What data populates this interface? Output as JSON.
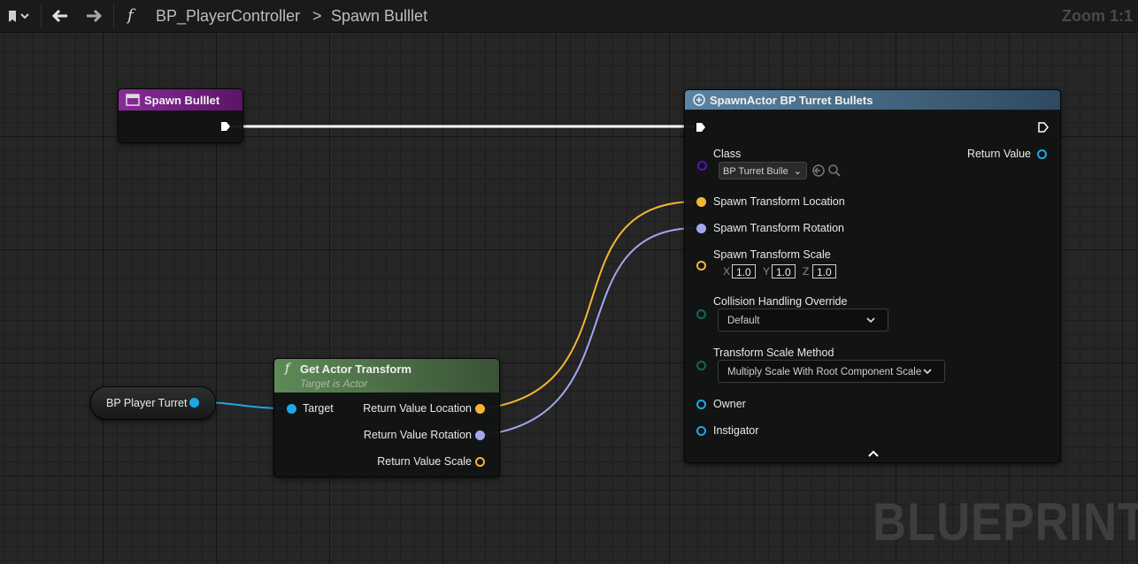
{
  "toolbar": {
    "function_symbol": "f",
    "breadcrumb_root": "BP_PlayerController",
    "breadcrumb_separator": ">",
    "breadcrumb_current": "Spawn Bulllet",
    "zoom": "Zoom 1:1"
  },
  "nodes": {
    "event": {
      "title": "Spawn Bulllet"
    },
    "variable": {
      "label": "BP Player Turret"
    },
    "get_transform": {
      "symbol": "f",
      "title": "Get Actor Transform",
      "subtitle": "Target is Actor",
      "target": "Target",
      "loc": "Return Value Location",
      "rot": "Return Value Rotation",
      "scale": "Return Value Scale"
    },
    "spawn": {
      "title": "SpawnActor BP Turret Bullets",
      "class_label": "Class",
      "class_value": "BP Turret Bulle",
      "return_value": "Return Value",
      "loc": "Spawn Transform Location",
      "rot": "Spawn Transform Rotation",
      "scale": "Spawn Transform Scale",
      "scale_x_label": "X",
      "scale_x": "1.0",
      "scale_y_label": "Y",
      "scale_y": "1.0",
      "scale_z_label": "Z",
      "scale_z": "1.0",
      "collision_label": "Collision Handling Override",
      "collision_value": "Default",
      "method_label": "Transform Scale Method",
      "method_value": "Multiply Scale With Root Component Scale",
      "owner": "Owner",
      "instigator": "Instigator"
    }
  },
  "colors": {
    "vector": "#f2b632",
    "rotator": "#a2a7f0",
    "object": "#1fa6e6",
    "class": "#5d0fbf",
    "enum": "#0b6b5c",
    "exec": "#ffffff",
    "event_header": "#7a1e8a",
    "function_header": "#4a6b45",
    "spawn_header": "#4b6a80"
  },
  "watermark": "BLUEPRINT"
}
